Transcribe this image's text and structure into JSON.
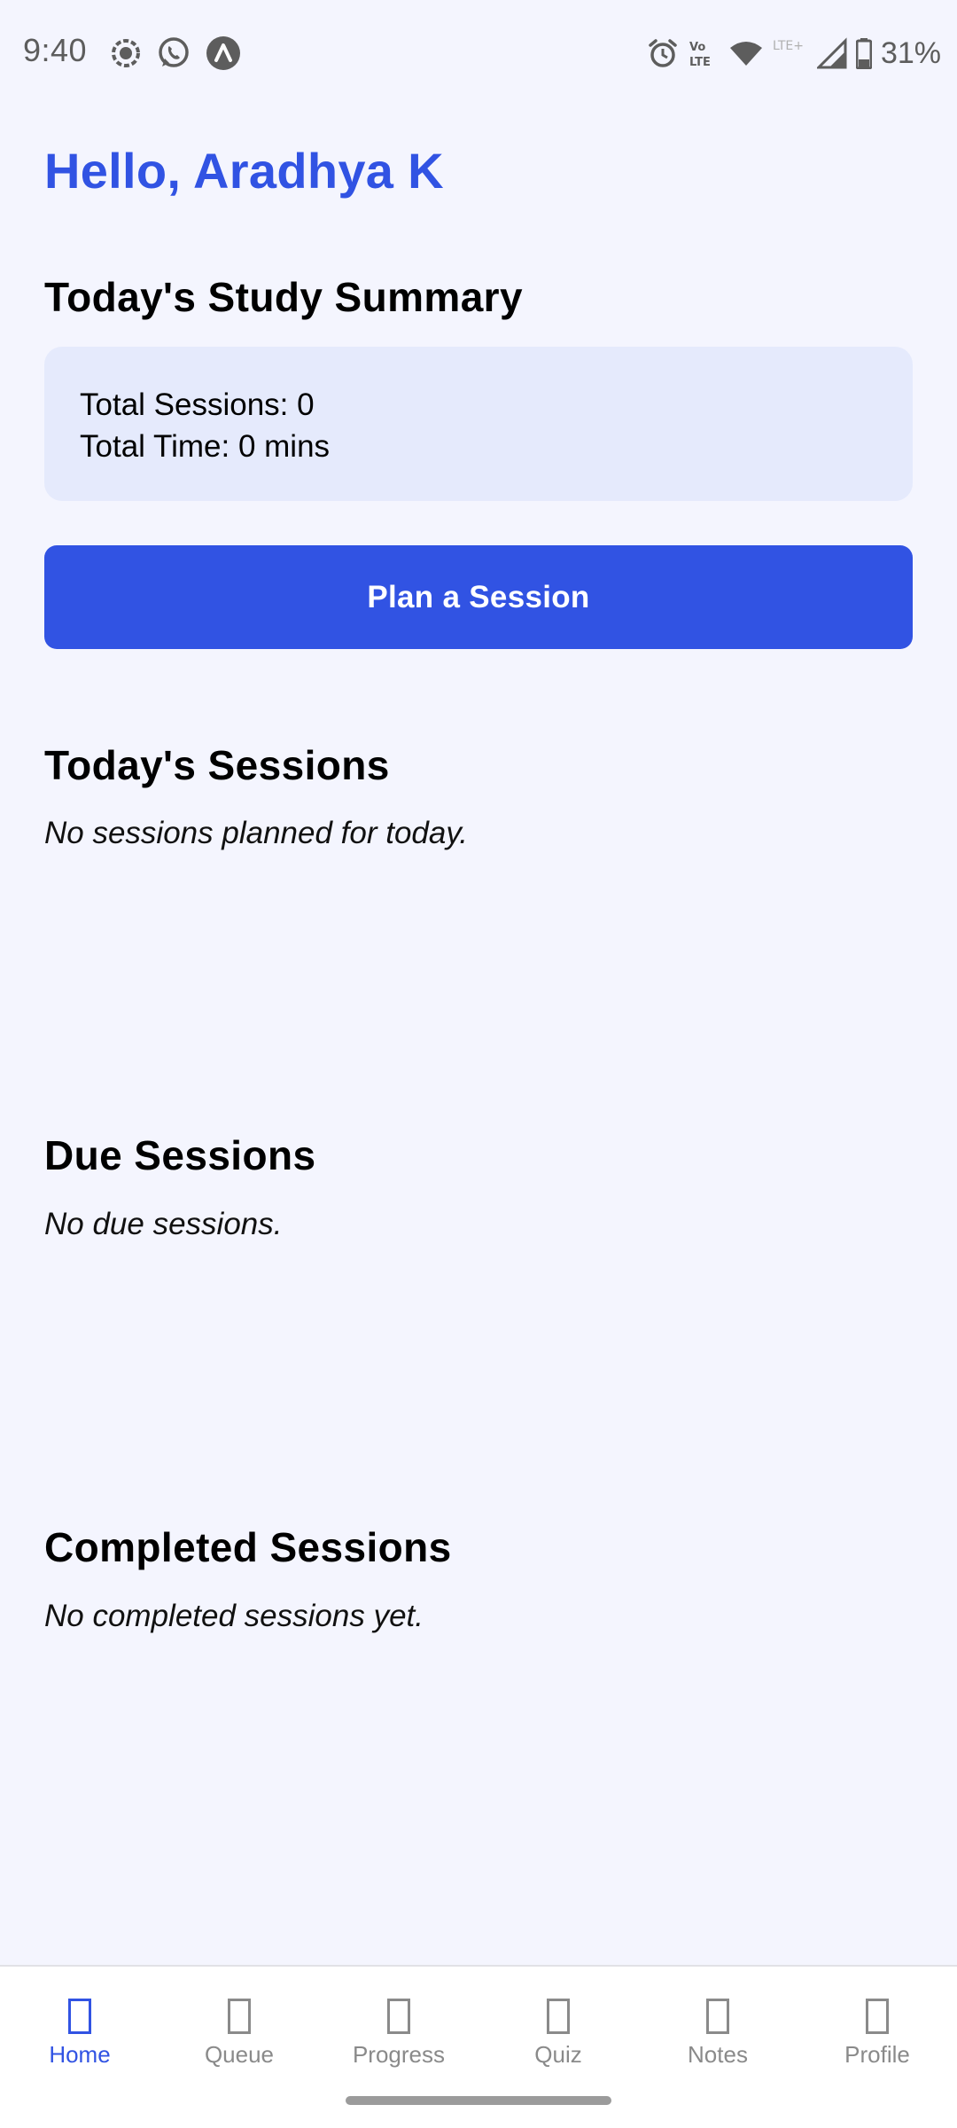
{
  "status_bar": {
    "time": "9:40",
    "battery_percent": "31%",
    "network_label": "LTE+",
    "volte_label": "Vo LTE",
    "icons_left": [
      "screen-record-icon",
      "whatsapp-icon",
      "app-notification-icon"
    ],
    "icons_right": [
      "alarm-icon",
      "volte-icon",
      "wifi-icon",
      "signal-icon",
      "battery-icon"
    ]
  },
  "greeting": "Hello, Aradhya K",
  "summary": {
    "title": "Today's Study Summary",
    "total_sessions": "Total Sessions: 0",
    "total_time": "Total Time: 0 mins"
  },
  "plan_button_label": "Plan a Session",
  "todays_sessions": {
    "title": "Today's Sessions",
    "empty_text": "No sessions planned for today."
  },
  "due_sessions": {
    "title": "Due Sessions",
    "empty_text": "No due sessions."
  },
  "completed_sessions": {
    "title": "Completed Sessions",
    "empty_text": "No completed sessions yet."
  },
  "nav": {
    "active": "Home",
    "items": [
      {
        "label": "Home",
        "icon": "home-icon"
      },
      {
        "label": "Queue",
        "icon": "queue-icon"
      },
      {
        "label": "Progress",
        "icon": "progress-icon"
      },
      {
        "label": "Quiz",
        "icon": "quiz-icon"
      },
      {
        "label": "Notes",
        "icon": "notes-icon"
      },
      {
        "label": "Profile",
        "icon": "profile-icon"
      }
    ]
  },
  "colors": {
    "accent": "#3153E3",
    "background": "#F4F5FE",
    "card": "#E5EAFC",
    "nav_inactive": "#8A8A8A"
  }
}
